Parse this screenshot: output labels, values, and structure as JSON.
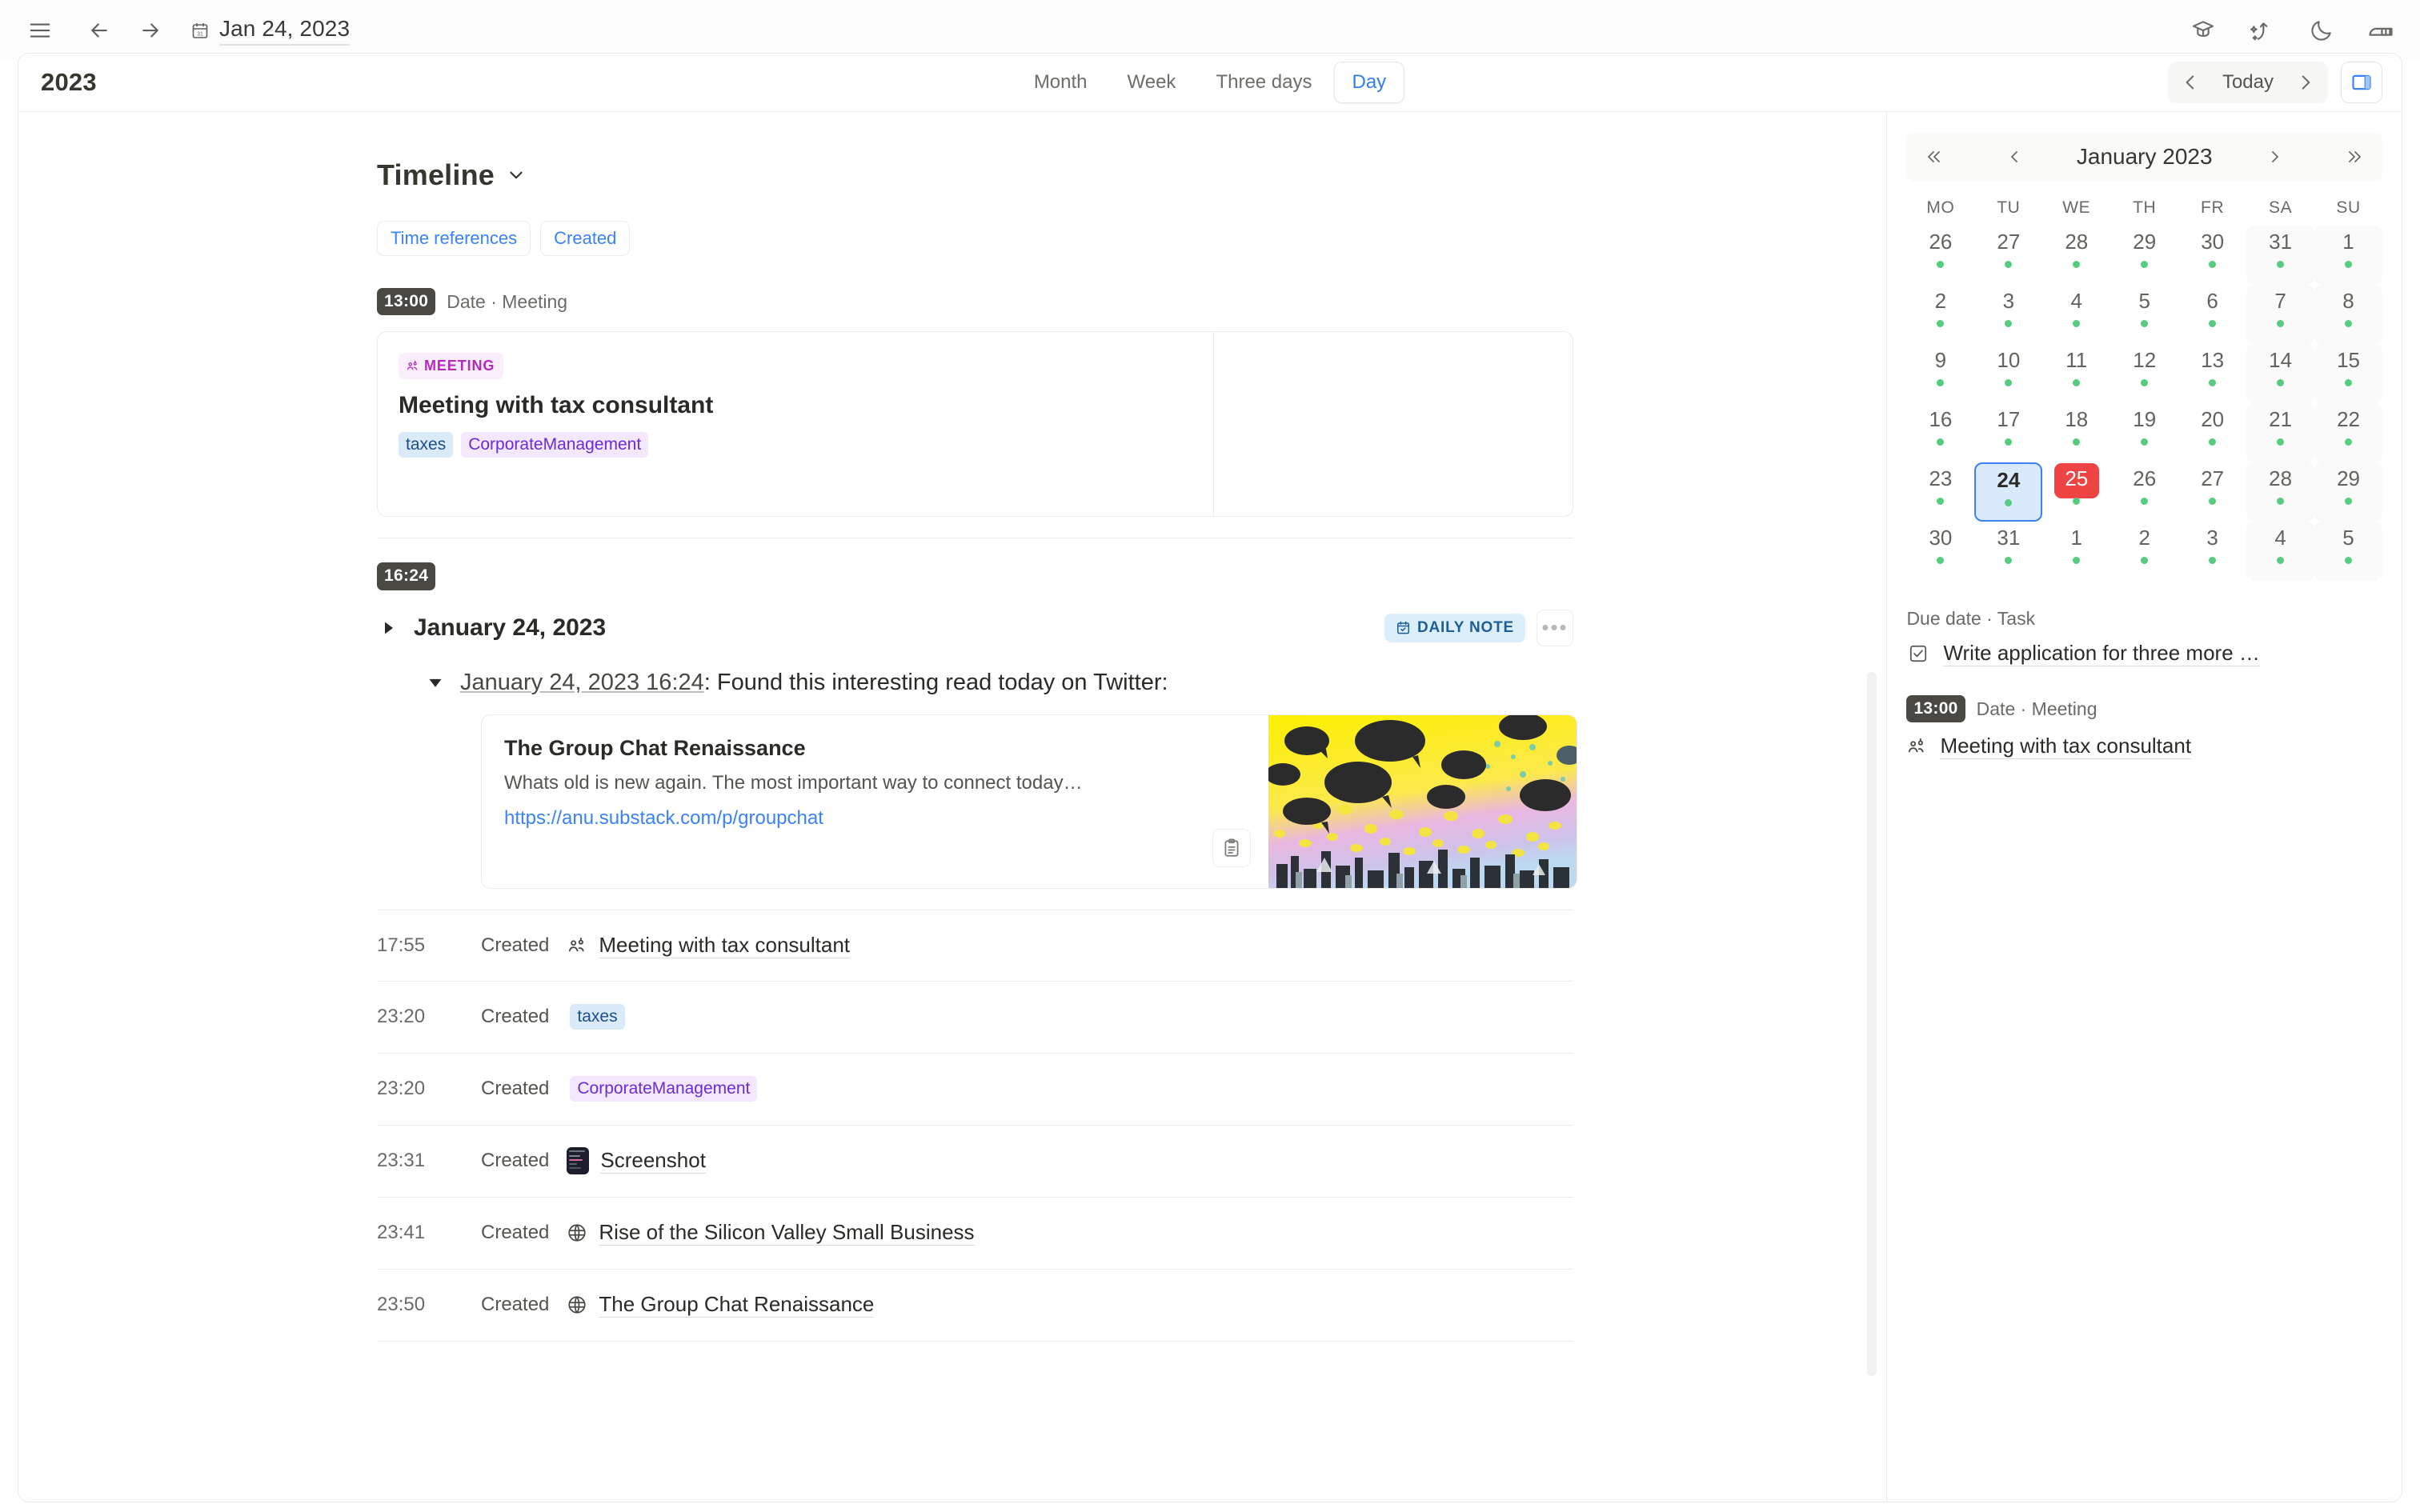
{
  "titlebar": {
    "menu_icon": "hamburger-menu-icon",
    "back_icon": "arrow-left-icon",
    "forward_icon": "arrow-right-icon",
    "doc_icon": "calendar-icon",
    "doc_title": "Jan 24, 2023",
    "right_icons": [
      "graduation-cap-icon",
      "magic-wand-icon",
      "moon-icon",
      "reader-icon"
    ]
  },
  "header": {
    "page_title": "2023",
    "tabs": [
      {
        "label": "Month",
        "active": false
      },
      {
        "label": "Week",
        "active": false
      },
      {
        "label": "Three days",
        "active": false
      },
      {
        "label": "Day",
        "active": true
      }
    ],
    "prev_icon": "chevron-left-icon",
    "today_label": "Today",
    "next_icon": "chevron-right-icon",
    "sidebar_toggle_icon": "right-sidebar-icon",
    "accent_color": "#2f7df6"
  },
  "timeline": {
    "title": "Timeline",
    "caret_icon": "chevron-down-icon",
    "filters": [
      {
        "label": "Time references"
      },
      {
        "label": "Created"
      }
    ],
    "event": {
      "time": "13:00",
      "meta": "Date · Meeting",
      "badge": "MEETING",
      "badge_icon": "people-tag-icon",
      "title": "Meeting with tax consultant",
      "tags": [
        {
          "label": "taxes",
          "color": "#1b4e8c",
          "bg": "#daeaf9"
        },
        {
          "label": "CorporateManagement",
          "color": "#6c2bd9",
          "bg": "#f3e8fd"
        }
      ]
    },
    "note_block": {
      "time": "16:24",
      "collapse_icon": "triangle-right-icon",
      "date_title": "January 24, 2023",
      "daily_note_badge": "DAILY NOTE",
      "daily_note_icon": "calendar-check-icon",
      "more_icon": "ellipsis-icon",
      "child_collapse_icon": "triangle-down-icon",
      "child_link": "January 24, 2023 16:24",
      "child_text": ": Found this interesting read today on Twitter:",
      "link_card": {
        "title": "The Group Chat Renaissance",
        "description": "Whats old is new again. The most important way to connect today…",
        "url": "https://anu.substack.com/p/groupchat",
        "clipboard_icon": "clipboard-icon",
        "thumbnail_alt": "yellow-speech-bubbles-skyline-illustration"
      }
    },
    "created_rows": [
      {
        "time": "17:55",
        "verb": "Created",
        "icon": "people-tag-icon",
        "label": "Meeting with tax consultant",
        "kind": "link"
      },
      {
        "time": "23:20",
        "verb": "Created",
        "icon": "",
        "label": "taxes",
        "kind": "tag",
        "color": "#1b4e8c",
        "bg": "#daeaf9"
      },
      {
        "time": "23:20",
        "verb": "Created",
        "icon": "",
        "label": "CorporateManagement",
        "kind": "tag",
        "color": "#6c2bd9",
        "bg": "#f3e8fd"
      },
      {
        "time": "23:31",
        "verb": "Created",
        "icon": "screenshot-thumbnail-icon",
        "label": "Screenshot",
        "kind": "link"
      },
      {
        "time": "23:41",
        "verb": "Created",
        "icon": "globe-icon",
        "label": "Rise of the Silicon Valley Small Business",
        "kind": "link"
      },
      {
        "time": "23:50",
        "verb": "Created",
        "icon": "globe-icon",
        "label": "The Group Chat Renaissance",
        "kind": "link"
      }
    ]
  },
  "calendar": {
    "first_icon": "chevron-double-left-icon",
    "prev_icon": "chevron-left-icon",
    "month_label": "January 2023",
    "next_icon": "chevron-right-icon",
    "last_icon": "chevron-double-right-icon",
    "weekdays": [
      "MO",
      "TU",
      "WE",
      "TH",
      "FR",
      "SA",
      "SU"
    ],
    "dot_color": "#56cc7e",
    "selected_color": "#3b82f6",
    "today_color": "#ef4444",
    "weeks": [
      [
        {
          "d": "26",
          "dot": true
        },
        {
          "d": "27",
          "dot": true
        },
        {
          "d": "28",
          "dot": true
        },
        {
          "d": "29",
          "dot": true
        },
        {
          "d": "30",
          "dot": true
        },
        {
          "d": "31",
          "dot": true,
          "weekend": true
        },
        {
          "d": "1",
          "dot": true,
          "weekend": true
        }
      ],
      [
        {
          "d": "2",
          "dot": true
        },
        {
          "d": "3",
          "dot": true
        },
        {
          "d": "4",
          "dot": true
        },
        {
          "d": "5",
          "dot": true
        },
        {
          "d": "6",
          "dot": true
        },
        {
          "d": "7",
          "dot": true,
          "weekend": true
        },
        {
          "d": "8",
          "dot": true,
          "weekend": true
        }
      ],
      [
        {
          "d": "9",
          "dot": true
        },
        {
          "d": "10",
          "dot": true
        },
        {
          "d": "11",
          "dot": true
        },
        {
          "d": "12",
          "dot": true
        },
        {
          "d": "13",
          "dot": true
        },
        {
          "d": "14",
          "dot": true,
          "weekend": true
        },
        {
          "d": "15",
          "dot": true,
          "weekend": true
        }
      ],
      [
        {
          "d": "16",
          "dot": true
        },
        {
          "d": "17",
          "dot": true
        },
        {
          "d": "18",
          "dot": true
        },
        {
          "d": "19",
          "dot": true
        },
        {
          "d": "20",
          "dot": true
        },
        {
          "d": "21",
          "dot": true,
          "weekend": true
        },
        {
          "d": "22",
          "dot": true,
          "weekend": true
        }
      ],
      [
        {
          "d": "23",
          "dot": true
        },
        {
          "d": "24",
          "dot": true,
          "selected": true
        },
        {
          "d": "25",
          "dot": true,
          "today": true
        },
        {
          "d": "26",
          "dot": true
        },
        {
          "d": "27",
          "dot": true
        },
        {
          "d": "28",
          "dot": true,
          "weekend": true
        },
        {
          "d": "29",
          "dot": true,
          "weekend": true
        }
      ],
      [
        {
          "d": "30",
          "dot": true
        },
        {
          "d": "31",
          "dot": true
        },
        {
          "d": "1",
          "dot": true
        },
        {
          "d": "2",
          "dot": true
        },
        {
          "d": "3",
          "dot": true
        },
        {
          "d": "4",
          "dot": true,
          "weekend": true
        },
        {
          "d": "5",
          "dot": true,
          "weekend": true
        }
      ]
    ]
  },
  "agenda": {
    "task_label": "Due date · Task",
    "task_check_icon": "checkbox-checked-icon",
    "task_text": "Write application for three more …",
    "meeting_time": "13:00",
    "meeting_meta": "Date · Meeting",
    "meeting_icon": "people-tag-icon",
    "meeting_text": "Meeting with tax consultant"
  }
}
